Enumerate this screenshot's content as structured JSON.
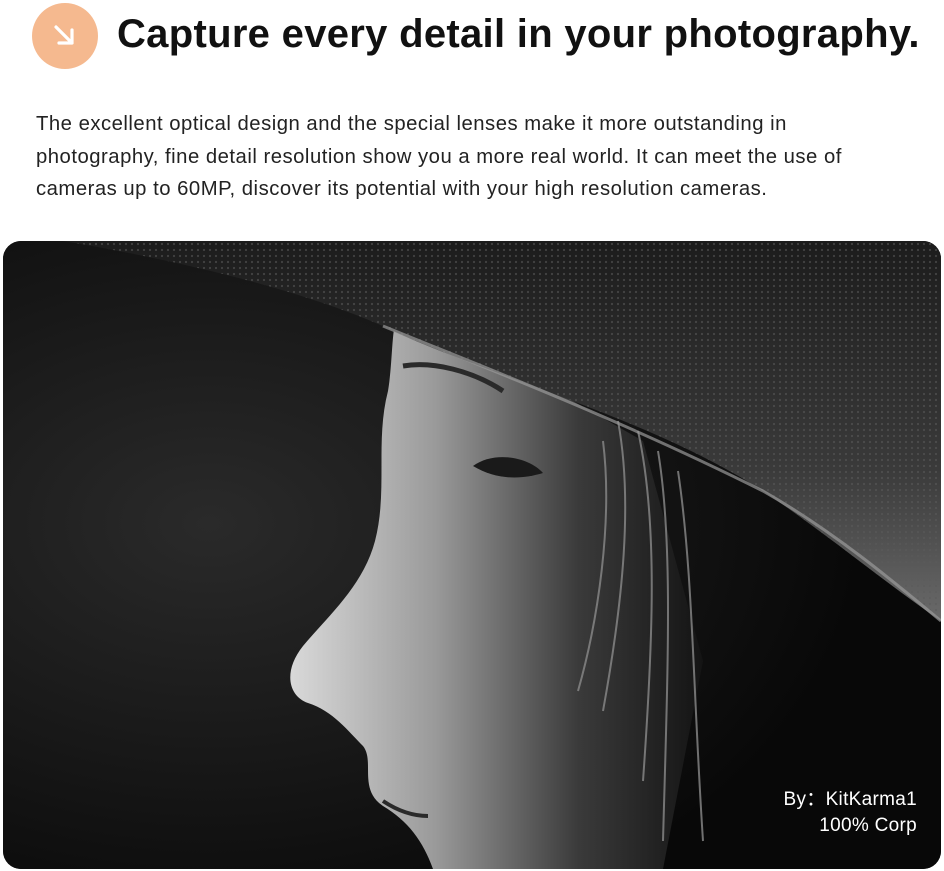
{
  "header": {
    "badge_icon": "arrow-down-right-icon",
    "badge_color": "#f5b98f",
    "title": "Capture every detail in your photography."
  },
  "description": "The excellent optical design and the special lenses make it more outstanding in photography, fine detail resolution show you a more real world. It can  meet the use of cameras up to 60MP, discover its potential with your high resolution cameras.",
  "photo": {
    "subject": "black-and-white profile portrait of a woman wearing a wide-brimmed hat",
    "credit_line1": "By：KitKarma1",
    "credit_line2": "100% Corp"
  }
}
